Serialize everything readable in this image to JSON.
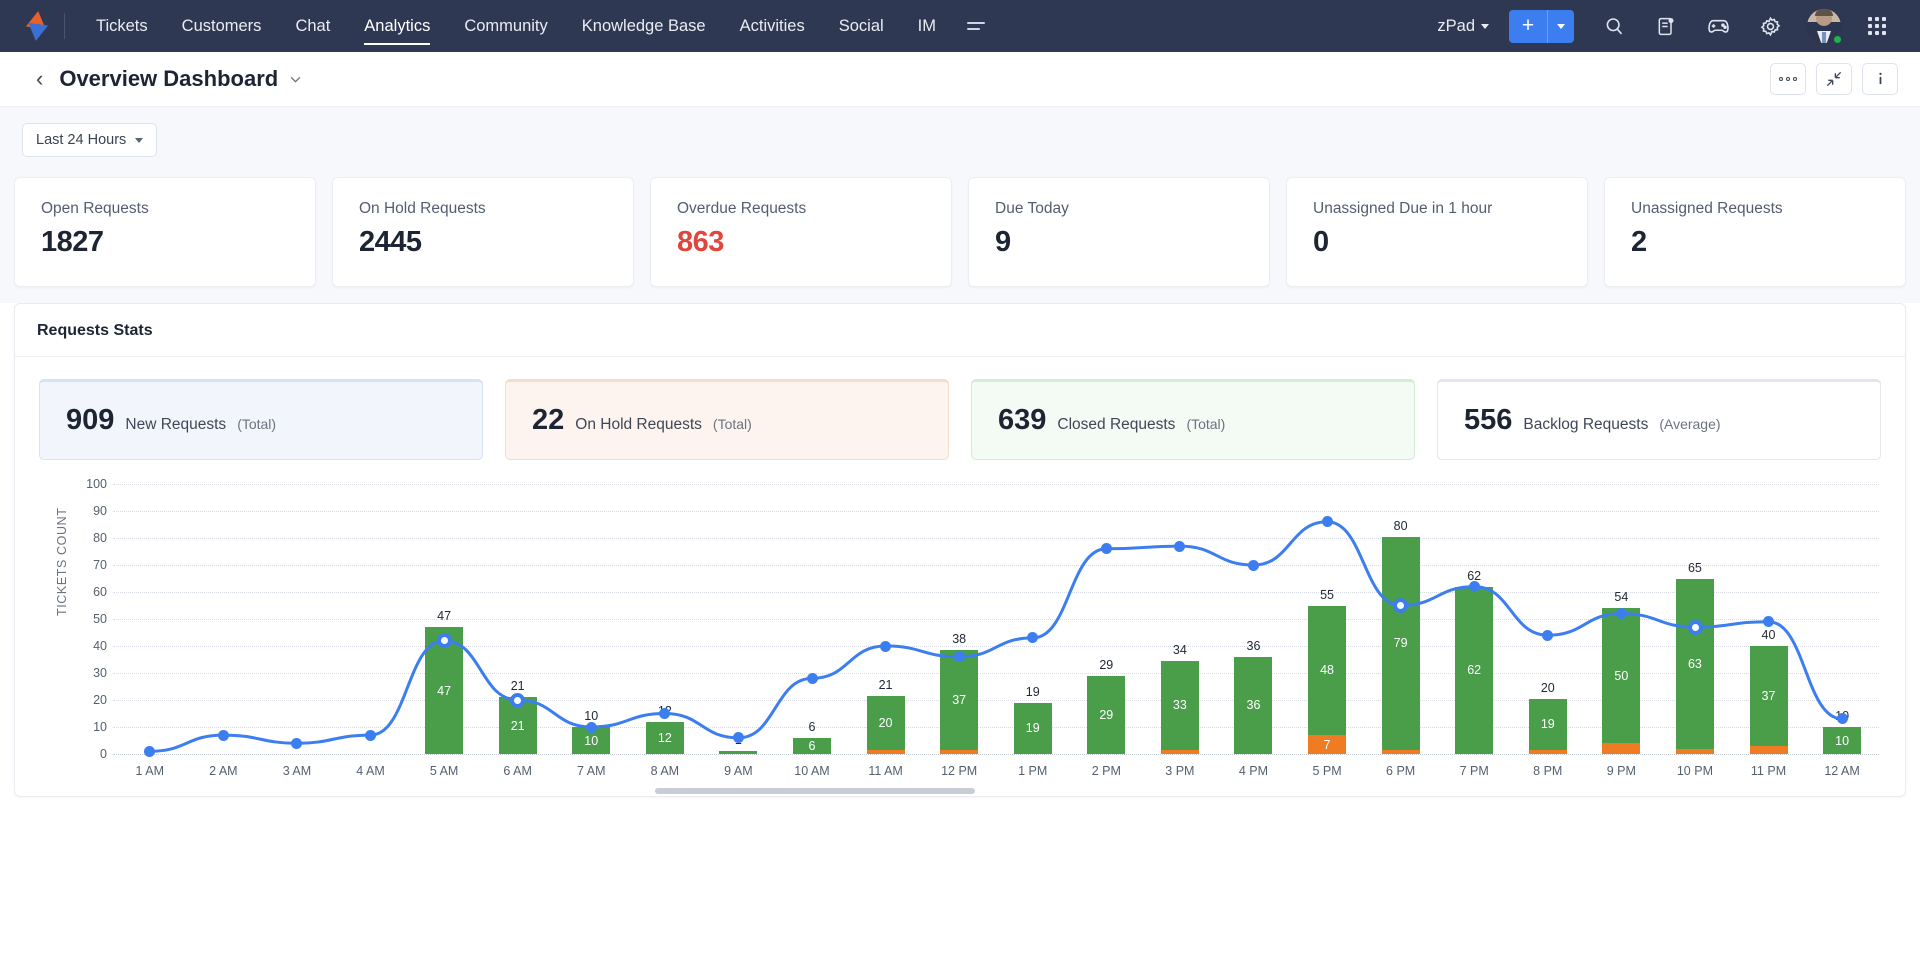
{
  "topnav": {
    "logo_icon": "zoho-desk-logo",
    "items": [
      {
        "label": "Tickets",
        "active": false
      },
      {
        "label": "Customers",
        "active": false
      },
      {
        "label": "Chat",
        "active": false
      },
      {
        "label": "Analytics",
        "active": true
      },
      {
        "label": "Community",
        "active": false
      },
      {
        "label": "Knowledge Base",
        "active": false
      },
      {
        "label": "Activities",
        "active": false
      },
      {
        "label": "Social",
        "active": false
      },
      {
        "label": "IM",
        "active": false
      }
    ],
    "more_icon": "hamburger-icon",
    "department": "zPad",
    "add_label": "+",
    "icons": [
      "search-icon",
      "notes-icon",
      "game-controller-icon",
      "gear-icon",
      "avatar",
      "app-grid-icon"
    ],
    "accent_blue": "#3c7ef0",
    "bar_bg": "#2f3852"
  },
  "header": {
    "back_icon": "chevron-left-icon",
    "title": "Overview Dashboard",
    "title_caret": "caret-down-icon",
    "actions": [
      {
        "name": "more-options-button",
        "icon": "ellipsis-icon"
      },
      {
        "name": "collapse-button",
        "icon": "collapse-arrows-icon"
      },
      {
        "name": "info-button",
        "icon": "info-icon"
      }
    ]
  },
  "filter": {
    "range_label": "Last 24 Hours",
    "caret": "caret-down-icon"
  },
  "kpis": [
    {
      "label": "Open Requests",
      "value": "1827",
      "danger": false
    },
    {
      "label": "On Hold Requests",
      "value": "2445",
      "danger": false
    },
    {
      "label": "Overdue Requests",
      "value": "863",
      "danger": true
    },
    {
      "label": "Due Today",
      "value": "9",
      "danger": false
    },
    {
      "label": "Unassigned Due in 1 hour",
      "value": "0",
      "danger": false
    },
    {
      "label": "Unassigned Requests",
      "value": "2",
      "danger": false
    }
  ],
  "stats_panel": {
    "title": "Requests Stats",
    "tabs": [
      {
        "value": "909",
        "label": "New Requests",
        "qualifier": "(Total)",
        "theme": "blue",
        "accent": "#2f72d6"
      },
      {
        "value": "22",
        "label": "On Hold Requests",
        "qualifier": "(Total)",
        "theme": "orange",
        "accent": "#e8742a"
      },
      {
        "value": "639",
        "label": "Closed Requests",
        "qualifier": "(Total)",
        "theme": "green",
        "accent": "#3f9e3f"
      },
      {
        "value": "556",
        "label": "Backlog Requests",
        "qualifier": "(Average)",
        "theme": "plain",
        "accent": "#ffffff"
      }
    ]
  },
  "chart_data": {
    "type": "bar",
    "title": "",
    "xlabel": "",
    "ylabel": "TICKETS COUNT",
    "ylim": [
      0,
      100
    ],
    "yticks": [
      0,
      10,
      20,
      30,
      40,
      50,
      60,
      70,
      80,
      90,
      100
    ],
    "grid": true,
    "legend": "none",
    "stacked": true,
    "categories": [
      "1 AM",
      "2 AM",
      "3 AM",
      "4 AM",
      "5 AM",
      "6 AM",
      "7 AM",
      "8 AM",
      "9 AM",
      "10 AM",
      "11 AM",
      "12 PM",
      "1 PM",
      "2 PM",
      "3 PM",
      "4 PM",
      "5 PM",
      "6 PM",
      "7 PM",
      "8 PM",
      "9 PM",
      "10 PM",
      "11 PM",
      "12 AM"
    ],
    "totals": [
      null,
      null,
      null,
      null,
      47,
      21,
      10,
      12,
      1,
      6,
      21,
      38,
      19,
      29,
      34,
      36,
      55,
      80,
      62,
      20,
      54,
      65,
      40,
      10
    ],
    "series": [
      {
        "name": "Closed Requests",
        "color": "#4a9e4a",
        "values": [
          0,
          0,
          0,
          0,
          47,
          21,
          10,
          12,
          1,
          6,
          20,
          37,
          19,
          29,
          33,
          36,
          48,
          79,
          62,
          19,
          50,
          63,
          37,
          10
        ]
      },
      {
        "name": "On Hold Requests",
        "color": "#ef7c23",
        "values": [
          0,
          0,
          0,
          0,
          0,
          0,
          0,
          0,
          0,
          0,
          1,
          1,
          0,
          0,
          1,
          0,
          7,
          1,
          0,
          1,
          4,
          2,
          3,
          0
        ]
      },
      {
        "name": "New Requests",
        "type": "line",
        "color": "#3c7ef0",
        "values": [
          1,
          7,
          4,
          7,
          42,
          20,
          10,
          15,
          6,
          28,
          40,
          36,
          43,
          76,
          77,
          70,
          86,
          55,
          62,
          44,
          52,
          47,
          49,
          13
        ]
      }
    ],
    "highlighted_points": [
      4,
      5,
      17,
      21
    ]
  }
}
